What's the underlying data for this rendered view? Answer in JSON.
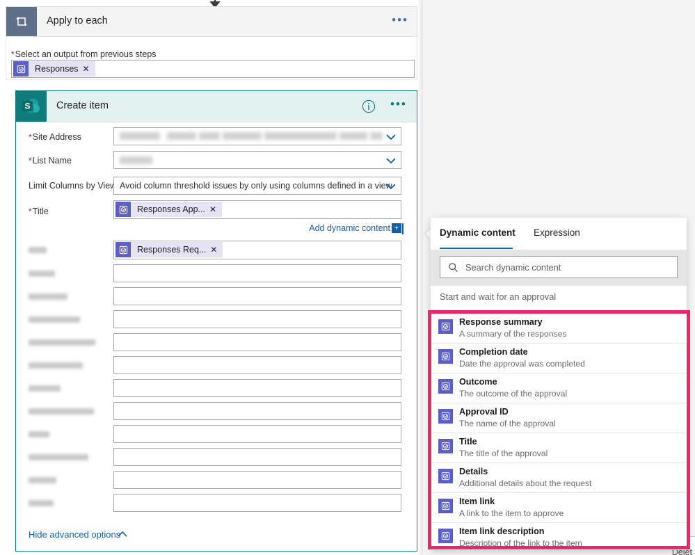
{
  "connector": {
    "icon": "arrow-down-icon"
  },
  "apply_to_each": {
    "icon": "loop-icon",
    "title": "Apply to each",
    "overflow": "•••",
    "output_label": "Select an output from previous steps",
    "required_marker": "*",
    "token": {
      "label": "Responses",
      "remove": "✕",
      "icon": "dynamic-content-icon"
    }
  },
  "create_item": {
    "icon": "sharepoint-icon",
    "icon_letter": "S",
    "title": "Create item",
    "info": "i",
    "overflow": "•••",
    "border_color": "#0f7b7b",
    "header_bg": "#e3f1f1",
    "fields": [
      {
        "label": "Site Address",
        "required": true,
        "type": "dropdown",
        "value": "",
        "redacted": true
      },
      {
        "label": "List Name",
        "required": true,
        "type": "dropdown",
        "value": "",
        "redacted": true
      },
      {
        "label": "Limit Columns by View",
        "required": false,
        "type": "dropdown",
        "value": "Avoid column threshold issues by only using columns defined in a view",
        "redacted": false
      },
      {
        "label": "Title",
        "required": true,
        "type": "token",
        "token": "Responses App...",
        "remove": "✕"
      }
    ],
    "add_dynamic_content": {
      "label": "Add dynamic content",
      "plus": "+"
    },
    "token_field": {
      "token": "Responses Req...",
      "remove": "✕",
      "label_redacted": true
    },
    "blank_field_count": 11,
    "hide_advanced": {
      "label": "Hide advanced options",
      "chevron": "chevron-up-icon"
    }
  },
  "dynamic_content": {
    "tabs": [
      {
        "label": "Dynamic content",
        "active": true
      },
      {
        "label": "Expression",
        "active": false
      }
    ],
    "search": {
      "placeholder": "Search dynamic content",
      "value": "",
      "icon": "search-icon"
    },
    "group_title": "Start and wait for an approval",
    "highlight_color": "#f0246a",
    "items": [
      {
        "name": "Response summary",
        "desc": "A summary of the responses"
      },
      {
        "name": "Completion date",
        "desc": "Date the approval was completed"
      },
      {
        "name": "Outcome",
        "desc": "The outcome of the approval"
      },
      {
        "name": "Approval ID",
        "desc": "The name of the approval"
      },
      {
        "name": "Title",
        "desc": "The title of the approval"
      },
      {
        "name": "Details",
        "desc": "Additional details about the request"
      },
      {
        "name": "Item link",
        "desc": "A link to the item to approve"
      },
      {
        "name": "Item link description",
        "desc": "Description of the link to the item"
      }
    ]
  },
  "background": {
    "delete_ghost": "Delet"
  }
}
